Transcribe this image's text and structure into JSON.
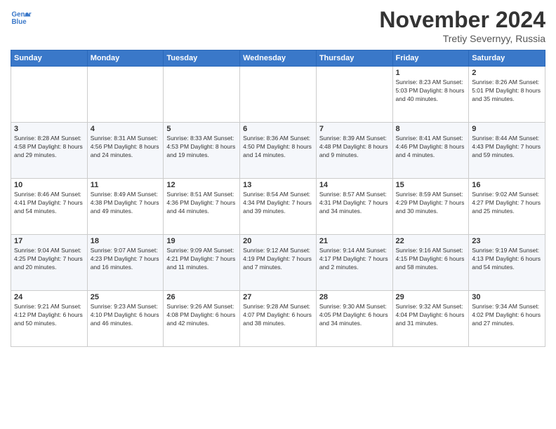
{
  "logo": {
    "line1": "General",
    "line2": "Blue"
  },
  "header": {
    "month": "November 2024",
    "location": "Tretiy Severnyy, Russia"
  },
  "weekdays": [
    "Sunday",
    "Monday",
    "Tuesday",
    "Wednesday",
    "Thursday",
    "Friday",
    "Saturday"
  ],
  "weeks": [
    [
      {
        "day": "",
        "info": ""
      },
      {
        "day": "",
        "info": ""
      },
      {
        "day": "",
        "info": ""
      },
      {
        "day": "",
        "info": ""
      },
      {
        "day": "",
        "info": ""
      },
      {
        "day": "1",
        "info": "Sunrise: 8:23 AM\nSunset: 5:03 PM\nDaylight: 8 hours and 40 minutes."
      },
      {
        "day": "2",
        "info": "Sunrise: 8:26 AM\nSunset: 5:01 PM\nDaylight: 8 hours and 35 minutes."
      }
    ],
    [
      {
        "day": "3",
        "info": "Sunrise: 8:28 AM\nSunset: 4:58 PM\nDaylight: 8 hours and 29 minutes."
      },
      {
        "day": "4",
        "info": "Sunrise: 8:31 AM\nSunset: 4:56 PM\nDaylight: 8 hours and 24 minutes."
      },
      {
        "day": "5",
        "info": "Sunrise: 8:33 AM\nSunset: 4:53 PM\nDaylight: 8 hours and 19 minutes."
      },
      {
        "day": "6",
        "info": "Sunrise: 8:36 AM\nSunset: 4:50 PM\nDaylight: 8 hours and 14 minutes."
      },
      {
        "day": "7",
        "info": "Sunrise: 8:39 AM\nSunset: 4:48 PM\nDaylight: 8 hours and 9 minutes."
      },
      {
        "day": "8",
        "info": "Sunrise: 8:41 AM\nSunset: 4:46 PM\nDaylight: 8 hours and 4 minutes."
      },
      {
        "day": "9",
        "info": "Sunrise: 8:44 AM\nSunset: 4:43 PM\nDaylight: 7 hours and 59 minutes."
      }
    ],
    [
      {
        "day": "10",
        "info": "Sunrise: 8:46 AM\nSunset: 4:41 PM\nDaylight: 7 hours and 54 minutes."
      },
      {
        "day": "11",
        "info": "Sunrise: 8:49 AM\nSunset: 4:38 PM\nDaylight: 7 hours and 49 minutes."
      },
      {
        "day": "12",
        "info": "Sunrise: 8:51 AM\nSunset: 4:36 PM\nDaylight: 7 hours and 44 minutes."
      },
      {
        "day": "13",
        "info": "Sunrise: 8:54 AM\nSunset: 4:34 PM\nDaylight: 7 hours and 39 minutes."
      },
      {
        "day": "14",
        "info": "Sunrise: 8:57 AM\nSunset: 4:31 PM\nDaylight: 7 hours and 34 minutes."
      },
      {
        "day": "15",
        "info": "Sunrise: 8:59 AM\nSunset: 4:29 PM\nDaylight: 7 hours and 30 minutes."
      },
      {
        "day": "16",
        "info": "Sunrise: 9:02 AM\nSunset: 4:27 PM\nDaylight: 7 hours and 25 minutes."
      }
    ],
    [
      {
        "day": "17",
        "info": "Sunrise: 9:04 AM\nSunset: 4:25 PM\nDaylight: 7 hours and 20 minutes."
      },
      {
        "day": "18",
        "info": "Sunrise: 9:07 AM\nSunset: 4:23 PM\nDaylight: 7 hours and 16 minutes."
      },
      {
        "day": "19",
        "info": "Sunrise: 9:09 AM\nSunset: 4:21 PM\nDaylight: 7 hours and 11 minutes."
      },
      {
        "day": "20",
        "info": "Sunrise: 9:12 AM\nSunset: 4:19 PM\nDaylight: 7 hours and 7 minutes."
      },
      {
        "day": "21",
        "info": "Sunrise: 9:14 AM\nSunset: 4:17 PM\nDaylight: 7 hours and 2 minutes."
      },
      {
        "day": "22",
        "info": "Sunrise: 9:16 AM\nSunset: 4:15 PM\nDaylight: 6 hours and 58 minutes."
      },
      {
        "day": "23",
        "info": "Sunrise: 9:19 AM\nSunset: 4:13 PM\nDaylight: 6 hours and 54 minutes."
      }
    ],
    [
      {
        "day": "24",
        "info": "Sunrise: 9:21 AM\nSunset: 4:12 PM\nDaylight: 6 hours and 50 minutes."
      },
      {
        "day": "25",
        "info": "Sunrise: 9:23 AM\nSunset: 4:10 PM\nDaylight: 6 hours and 46 minutes."
      },
      {
        "day": "26",
        "info": "Sunrise: 9:26 AM\nSunset: 4:08 PM\nDaylight: 6 hours and 42 minutes."
      },
      {
        "day": "27",
        "info": "Sunrise: 9:28 AM\nSunset: 4:07 PM\nDaylight: 6 hours and 38 minutes."
      },
      {
        "day": "28",
        "info": "Sunrise: 9:30 AM\nSunset: 4:05 PM\nDaylight: 6 hours and 34 minutes."
      },
      {
        "day": "29",
        "info": "Sunrise: 9:32 AM\nSunset: 4:04 PM\nDaylight: 6 hours and 31 minutes."
      },
      {
        "day": "30",
        "info": "Sunrise: 9:34 AM\nSunset: 4:02 PM\nDaylight: 6 hours and 27 minutes."
      }
    ]
  ]
}
